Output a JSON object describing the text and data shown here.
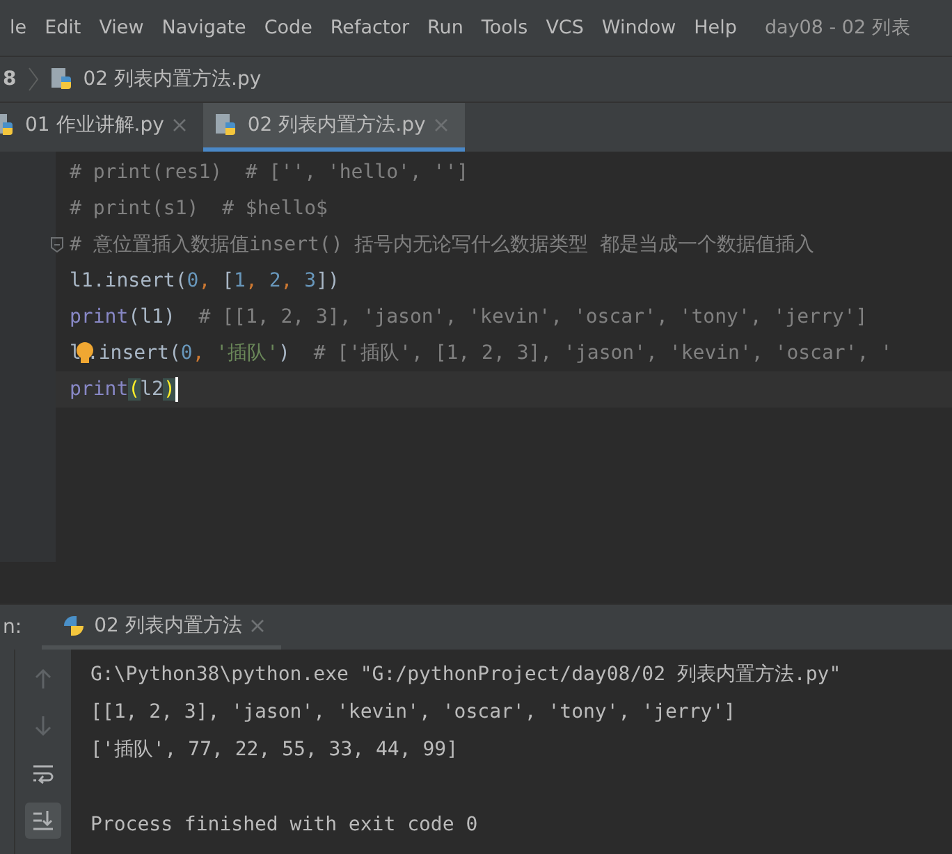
{
  "menu_bar": {
    "items": [
      "le",
      "Edit",
      "View",
      "Navigate",
      "Code",
      "Refactor",
      "Run",
      "Tools",
      "VCS",
      "Window",
      "Help"
    ],
    "window_title": "day08 - 02 列表"
  },
  "breadcrumb": {
    "items": [
      "8",
      "02 列表内置方法.py"
    ]
  },
  "editor_tabs": [
    {
      "label": "01 作业讲解.py",
      "selected": false
    },
    {
      "label": "02 列表内置方法.py",
      "selected": true
    }
  ],
  "code_lines": [
    {
      "current": false,
      "foldable": false,
      "tokens": [
        {
          "kind": "comment",
          "text": "# print(res1)  # ['', 'hello', '']"
        }
      ]
    },
    {
      "current": false,
      "foldable": false,
      "tokens": [
        {
          "kind": "comment",
          "text": "# print(s1)  # $hello$"
        }
      ]
    },
    {
      "current": false,
      "foldable": true,
      "tokens": [
        {
          "kind": "comment",
          "text": "# 意位置插入数据值insert() 括号内无论写什么数据类型 都是当成一个数据值插入"
        }
      ]
    },
    {
      "current": false,
      "foldable": false,
      "tokens": [
        {
          "kind": "plain",
          "text": "l1.insert("
        },
        {
          "kind": "number",
          "text": "0"
        },
        {
          "kind": "punct",
          "text": ", "
        },
        {
          "kind": "plain",
          "text": "["
        },
        {
          "kind": "number",
          "text": "1"
        },
        {
          "kind": "punct",
          "text": ", "
        },
        {
          "kind": "number",
          "text": "2"
        },
        {
          "kind": "punct",
          "text": ", "
        },
        {
          "kind": "number",
          "text": "3"
        },
        {
          "kind": "plain",
          "text": "])"
        }
      ]
    },
    {
      "current": false,
      "foldable": false,
      "tokens": [
        {
          "kind": "builtin",
          "text": "print"
        },
        {
          "kind": "plain",
          "text": "(l1)"
        },
        {
          "kind": "comment",
          "text": "  # [[1, 2, 3], 'jason', 'kevin', 'oscar', 'tony', 'jerry']"
        }
      ]
    },
    {
      "current": false,
      "foldable": false,
      "tokens": [
        {
          "kind": "plain",
          "text": "l"
        },
        {
          "kind": "bulb"
        },
        {
          "kind": "plain",
          "text": ".insert("
        },
        {
          "kind": "number",
          "text": "0"
        },
        {
          "kind": "punct",
          "text": ", "
        },
        {
          "kind": "string",
          "text": "'插队'"
        },
        {
          "kind": "plain",
          "text": ")"
        },
        {
          "kind": "comment",
          "text": "  # ['插队', [1, 2, 3], 'jason', 'kevin', 'oscar', '"
        }
      ]
    },
    {
      "current": true,
      "foldable": false,
      "tokens": [
        {
          "kind": "builtin",
          "text": "print"
        },
        {
          "kind": "paren",
          "text": "("
        },
        {
          "kind": "plain",
          "text": "l2"
        },
        {
          "kind": "paren",
          "text": ")"
        }
      ]
    }
  ],
  "run_panel": {
    "label": "n:",
    "tabs": [
      {
        "label": "02 列表内置方法",
        "selected": true
      }
    ],
    "toolbar": [
      {
        "kind": "up",
        "on": false
      },
      {
        "kind": "down",
        "on": false
      },
      {
        "kind": "wrap",
        "on": false
      },
      {
        "kind": "scroll_end",
        "on": true
      }
    ],
    "output": [
      "G:\\Python38\\python.exe \"G:/pythonProject/day08/02 列表内置方法.py\"",
      "[[1, 2, 3], 'jason', 'kevin', 'oscar', 'tony', 'jerry']",
      "['插队', 77, 22, 55, 33, 44, 99]",
      "Process finished with exit code 0"
    ]
  }
}
